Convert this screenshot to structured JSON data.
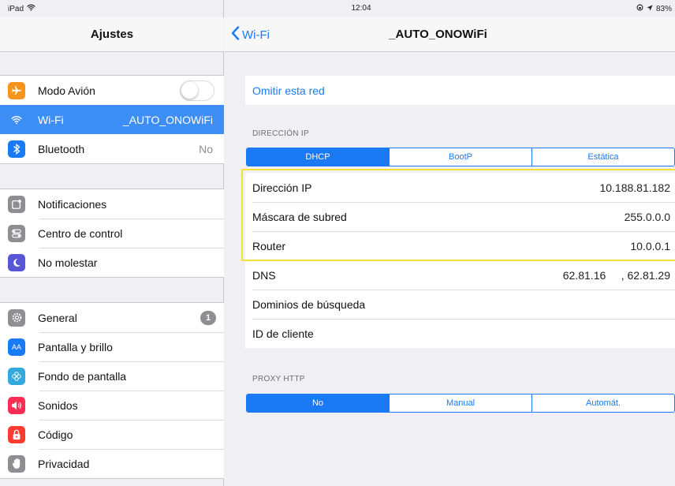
{
  "status_bar": {
    "device": "iPad",
    "time": "12:04",
    "battery": "83%"
  },
  "sidebar": {
    "title": "Ajustes",
    "groups": [
      [
        {
          "label": "Modo Avión",
          "icon": "airplane-icon",
          "color": "#f7941d",
          "control": "toggle",
          "value": ""
        },
        {
          "label": "Wi-Fi",
          "icon": "wifi-icon",
          "color": "#3d8ef5",
          "value": "_AUTO_ONOWiFi",
          "selected": true
        },
        {
          "label": "Bluetooth",
          "icon": "bluetooth-icon",
          "color": "#1a7af5",
          "value": "No"
        }
      ],
      [
        {
          "label": "Notificaciones",
          "icon": "notifications-icon",
          "color": "#8e8e93"
        },
        {
          "label": "Centro de control",
          "icon": "control-center-icon",
          "color": "#8e8e93"
        },
        {
          "label": "No molestar",
          "icon": "moon-icon",
          "color": "#5856d6"
        }
      ],
      [
        {
          "label": "General",
          "icon": "gear-icon",
          "color": "#8e8e93",
          "badge": "1"
        },
        {
          "label": "Pantalla y brillo",
          "icon": "brightness-icon",
          "color": "#1a7af5"
        },
        {
          "label": "Fondo de pantalla",
          "icon": "wallpaper-icon",
          "color": "#34aadc"
        },
        {
          "label": "Sonidos",
          "icon": "speaker-icon",
          "color": "#ff2d55"
        },
        {
          "label": "Código",
          "icon": "lock-icon",
          "color": "#ff3b30"
        },
        {
          "label": "Privacidad",
          "icon": "hand-icon",
          "color": "#8e8e93"
        }
      ]
    ]
  },
  "detail": {
    "back_label": "Wi-Fi",
    "title": "_AUTO_ONOWiFi",
    "forget_label": "Omitir esta red",
    "ip_section_label": "DIRECCIÓN IP",
    "ip_modes": [
      "DHCP",
      "BootP",
      "Estática"
    ],
    "ip_mode_selected": 0,
    "rows": [
      {
        "label": "Dirección IP",
        "value": "10.188.81.182"
      },
      {
        "label": "Máscara de subred",
        "value": "255.0.0.0"
      },
      {
        "label": "Router",
        "value": "10.0.0.1"
      },
      {
        "label": "DNS",
        "value": "62.81.16     , 62.81.29"
      },
      {
        "label": "Dominios de búsqueda",
        "value": ""
      },
      {
        "label": "ID de cliente",
        "value": ""
      }
    ],
    "proxy_section_label": "PROXY HTTP",
    "proxy_modes": [
      "No",
      "Manual",
      "Automát."
    ],
    "proxy_mode_selected": 0
  },
  "colors": {
    "accent": "#1a7af5",
    "highlight": "#f1e233",
    "selected_row": "#3d8ef5"
  }
}
